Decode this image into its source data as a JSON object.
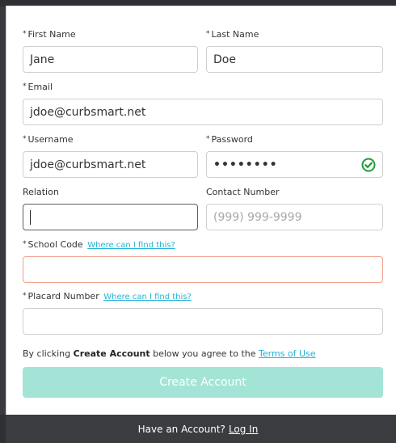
{
  "form": {
    "first_name": {
      "label": "First Name",
      "required": "*",
      "value": "Jane"
    },
    "last_name": {
      "label": "Last Name",
      "required": "*",
      "value": "Doe"
    },
    "email": {
      "label": "Email",
      "required": "*",
      "value": "jdoe@curbsmart.net"
    },
    "username": {
      "label": "Username",
      "required": "*",
      "value": "jdoe@curbsmart.net"
    },
    "password": {
      "label": "Password",
      "required": "*",
      "value": "••••••••"
    },
    "relation": {
      "label": "Relation",
      "value": ""
    },
    "contact_number": {
      "label": "Contact Number",
      "placeholder": "(999) 999-9999"
    },
    "school_code": {
      "label": "School Code",
      "required": "*",
      "help_link": "Where can I find this?"
    },
    "placard_number": {
      "label": "Placard Number",
      "required": "*",
      "help_link": "Where can I find this?"
    },
    "terms": {
      "prefix": "By clicking",
      "action": "Create Account",
      "middle": "below you agree to the",
      "link": "Terms of Use"
    },
    "submit_label": "Create Account"
  },
  "footer": {
    "text": "Have an Account?",
    "link": "Log In"
  },
  "colors": {
    "accent": "#25b3d3",
    "button": "#a4e4d6",
    "error_border": "#f3a08c",
    "success": "#1f9a3a"
  }
}
